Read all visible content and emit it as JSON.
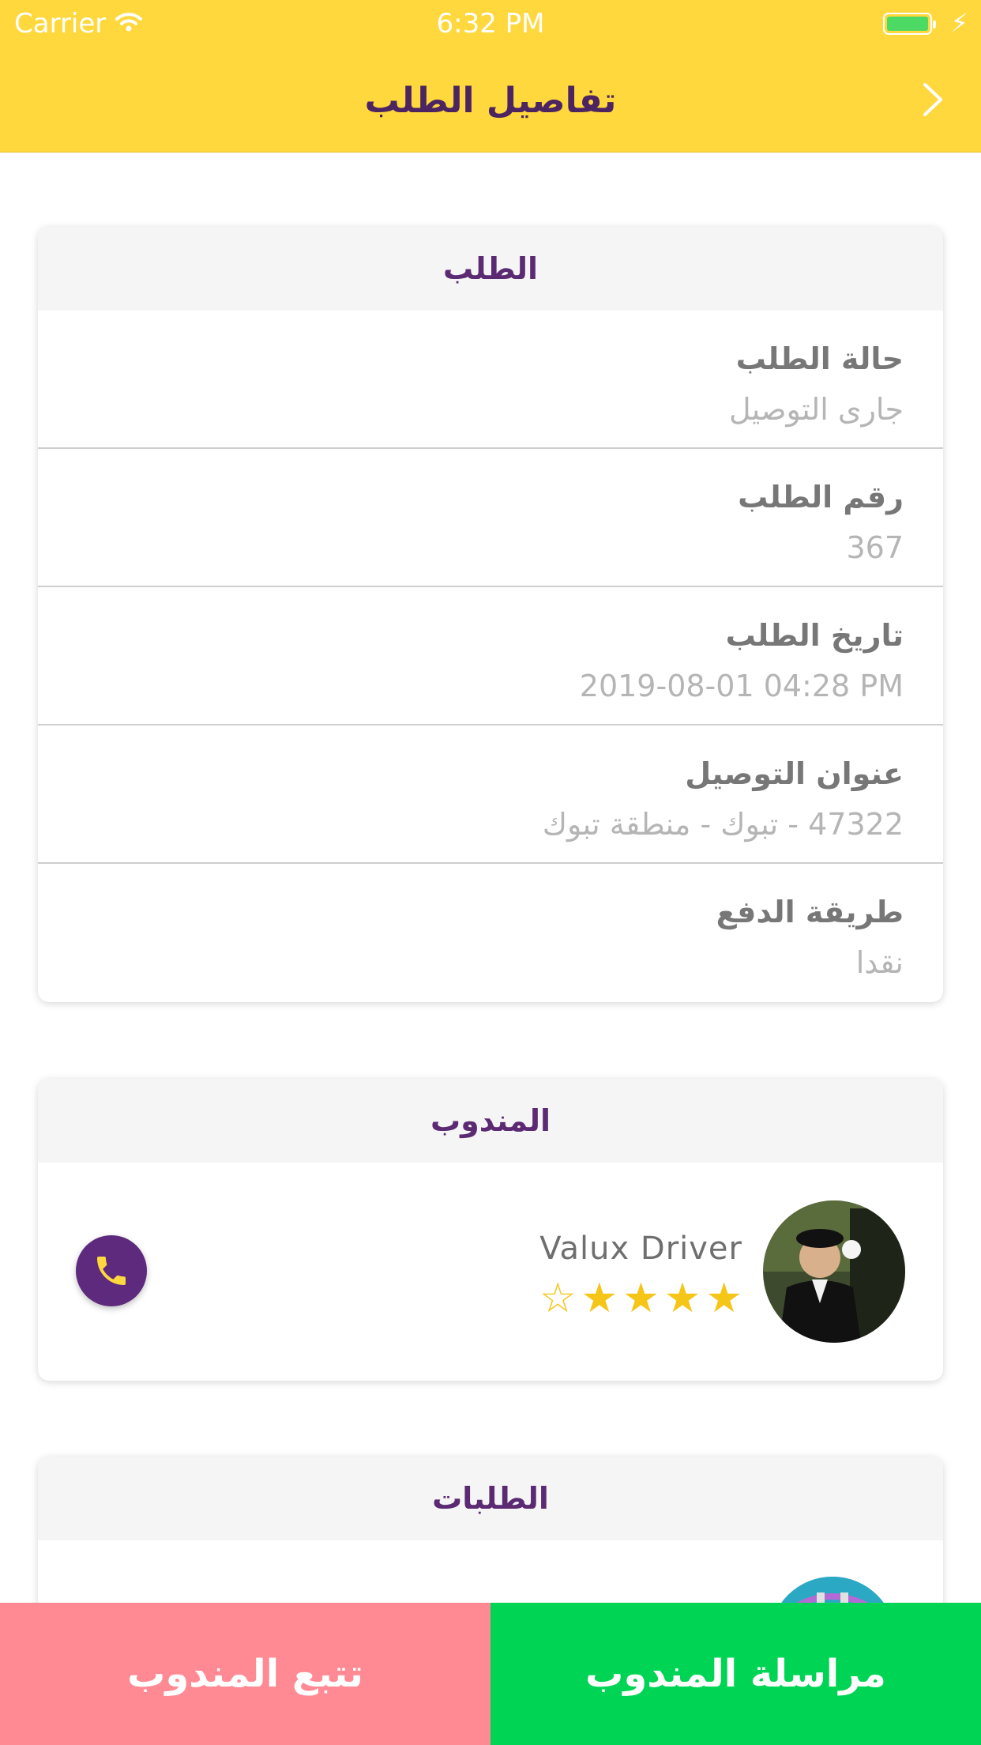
{
  "status_bar": {
    "carrier": "Carrier",
    "time": "6:32 PM"
  },
  "nav": {
    "title": "تفاصيل الطلب"
  },
  "order_card": {
    "header": "الطلب",
    "rows": [
      {
        "label": "حالة الطلب",
        "value": "جارى التوصيل"
      },
      {
        "label": "رقم الطلب",
        "value": "367"
      },
      {
        "label": "تاريخ الطلب",
        "value": "2019-08-01 04:28 PM"
      },
      {
        "label": "عنوان التوصيل",
        "value": "47322 - تبوك - منطقة تبوك"
      },
      {
        "label": "طريقة الدفع",
        "value": "نقدا"
      }
    ]
  },
  "driver_card": {
    "header": "المندوب",
    "name": "Valux Driver",
    "rating": 4,
    "rating_max": 5,
    "icons": {
      "call": "phone-icon",
      "avatar": "driver-avatar"
    }
  },
  "orders_card": {
    "header": "الطلبات"
  },
  "bottom_bar": {
    "track_label": "تتبع المندوب",
    "message_label": "مراسلة المندوب"
  },
  "colors": {
    "nav_bg": "#FFD83D",
    "accent_purple": "#5e2a7e",
    "track_button": "#FF8A94",
    "message_button": "#00D454",
    "star": "#F5C518"
  }
}
